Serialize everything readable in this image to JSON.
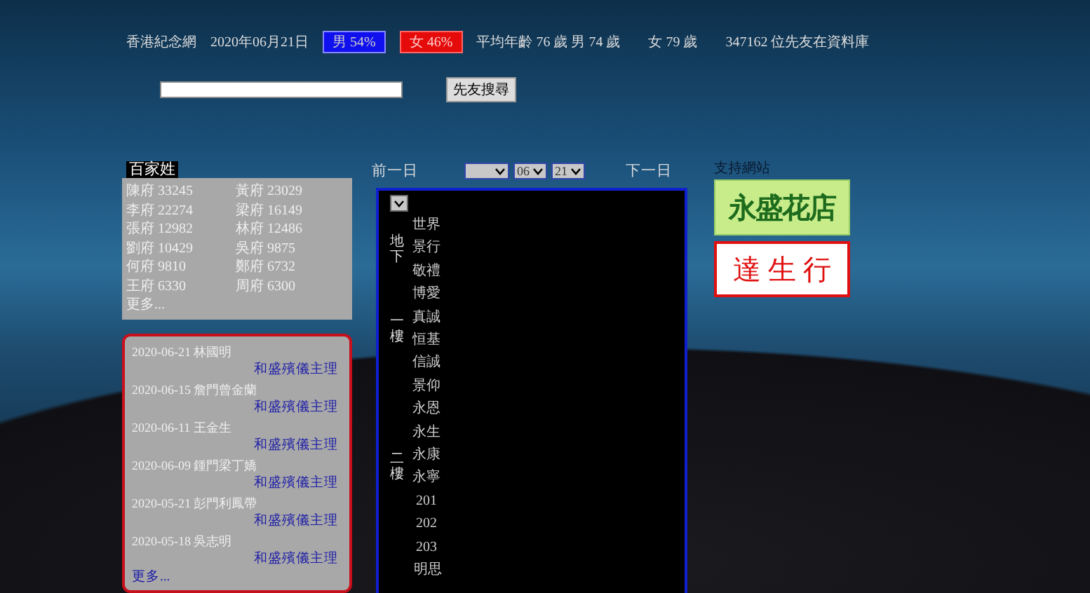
{
  "header": {
    "site": "香港紀念網",
    "date": "2020年06月21日",
    "male_share": "男 54%",
    "female_share": "女 46%",
    "average_age": "平均年齡 76 歲 男 74 歲",
    "female_age": "女 79 歲",
    "count": "347162 位先友在資料庫"
  },
  "search": {
    "button": "先友搜尋"
  },
  "surnames": {
    "title": "百家姓",
    "items": [
      {
        "label": "陳府 33245"
      },
      {
        "label": "黃府 23029"
      },
      {
        "label": "李府 22274"
      },
      {
        "label": "梁府 16149"
      },
      {
        "label": "張府 12982"
      },
      {
        "label": "林府 12486"
      },
      {
        "label": "劉府 10429"
      },
      {
        "label": "吳府 9875"
      },
      {
        "label": "何府 9810"
      },
      {
        "label": "鄭府 6732"
      },
      {
        "label": "王府 6330"
      },
      {
        "label": "周府 6300"
      }
    ],
    "more": "更多..."
  },
  "obituaries": {
    "items": [
      {
        "entry": "2020-06-21 林國明",
        "provider": "和盛殯儀主理"
      },
      {
        "entry": "2020-06-15 詹門曾金蘭",
        "provider": "和盛殯儀主理"
      },
      {
        "entry": "2020-06-11 王金生",
        "provider": "和盛殯儀主理"
      },
      {
        "entry": "2020-06-09 鍾門梁丁嬌",
        "provider": "和盛殯儀主理"
      },
      {
        "entry": "2020-05-21 彭門利鳳帶",
        "provider": "和盛殯儀主理"
      },
      {
        "entry": "2020-05-18 吳志明",
        "provider": "和盛殯儀主理"
      }
    ],
    "more": "更多..."
  },
  "date_nav": {
    "previous": "前一日",
    "next": "下一日",
    "month": "06",
    "day": "21"
  },
  "halls": {
    "groups": [
      {
        "floor": "地下",
        "rooms": [
          "世界",
          "景行",
          "敬禮"
        ]
      },
      {
        "floor": "一樓",
        "rooms": [
          "博愛",
          "真誠",
          "恒基",
          "信誠"
        ]
      },
      {
        "floor": "二樓",
        "rooms": [
          "景仰",
          "永恩",
          "永生",
          "永康",
          "永寧",
          "201",
          "202",
          "203"
        ]
      },
      {
        "rooms": [
          "明思"
        ]
      }
    ]
  },
  "sponsors": {
    "title": "支持網站",
    "items": [
      {
        "name": "永盛花店",
        "kind": "green"
      },
      {
        "name": "達 生 行",
        "kind": "red"
      }
    ]
  }
}
